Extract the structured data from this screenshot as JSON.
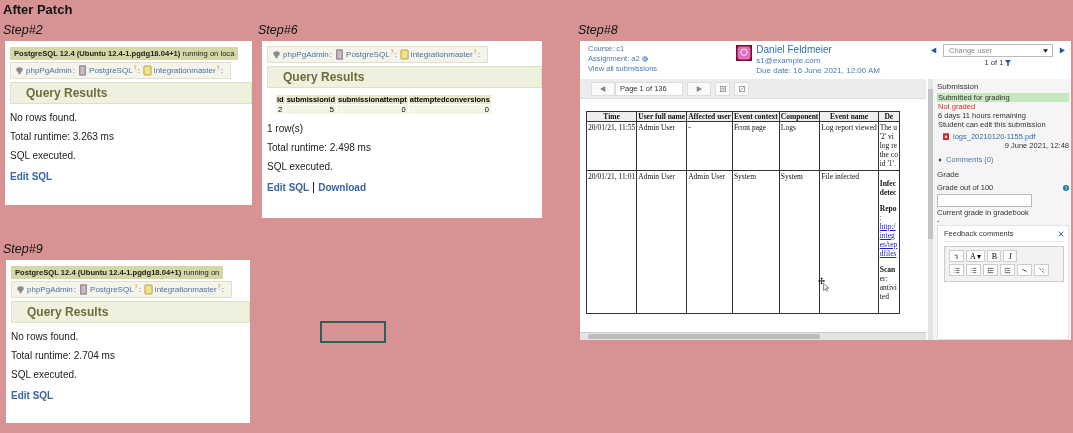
{
  "heading": "After Patch",
  "pg_panels": [
    {
      "step": "Step#2",
      "server_bar": {
        "bold": "PostgreSQL 12.4 (Ubuntu 12.4-1.pgdg18.04+1)",
        "rest": "running on loca"
      },
      "breadcrumb": [
        {
          "kind": "app",
          "label": "phpPgAdmin",
          "sep": ":"
        },
        {
          "kind": "server",
          "label": "PostgreSQL",
          "sep": ":"
        },
        {
          "kind": "database",
          "label": "integrationmaster",
          "sep": ":"
        }
      ],
      "title": "Query Results",
      "lines": [
        "No rows found.",
        "Total runtime: 3.263 ms",
        "SQL executed."
      ],
      "links": [
        "Edit SQL"
      ]
    },
    {
      "step": "Step#6",
      "breadcrumb": [
        {
          "kind": "app",
          "label": "phpPgAdmin",
          "sep": ":"
        },
        {
          "kind": "server",
          "label": "PostgreSQL",
          "sep": ":"
        },
        {
          "kind": "database",
          "label": "integrationmaster",
          "sep": ":"
        }
      ],
      "title": "Query Results",
      "table": {
        "columns": [
          "id",
          "submissionid",
          "submissionattempt",
          "attemptedconversions"
        ],
        "rows": [
          [
            "2",
            "5",
            "0",
            "0"
          ]
        ]
      },
      "lines": [
        "1 row(s)",
        "Total runtime: 2.498 ms",
        "SQL executed."
      ],
      "links": [
        "Edit SQL",
        "Download"
      ]
    },
    {
      "step": "Step#9",
      "server_bar": {
        "bold": "PostgreSQL 12.4 (Ubuntu 12.4-1.pgdg18.04+1)",
        "rest": "running on"
      },
      "breadcrumb": [
        {
          "kind": "app",
          "label": "phpPgAdmin",
          "sep": ":"
        },
        {
          "kind": "server",
          "label": "PostgreSQL",
          "sep": ":"
        },
        {
          "kind": "database",
          "label": "integrationmaster",
          "sep": ":"
        }
      ],
      "title": "Query Results",
      "lines": [
        "No rows found.",
        "Total runtime: 2.704 ms",
        "SQL executed."
      ],
      "links": [
        "Edit SQL"
      ]
    }
  ],
  "grading": {
    "step": "Step#8",
    "course": "Course: c1",
    "assignment": "Assignment: a2",
    "view_all": "View all submissions",
    "user_name": "Daniel Feldmeier",
    "user_email": "s1@example.com",
    "due_date": "Due date: 16 June 2021, 12:00 AM",
    "change_user": {
      "placeholder": "Change user"
    },
    "user_count": "1 of 1",
    "page_field": "Page 1 of 136",
    "log_table": {
      "columns": [
        "Time",
        "User full name",
        "Affected user",
        "Event context",
        "Component",
        "Event name",
        "De"
      ],
      "rows": [
        {
          "cells": [
            "20/01/21, 11:55",
            "Admin User",
            "-",
            "Front page",
            "Logs",
            "Log report viewed"
          ],
          "description": [
            {
              "kind": "text",
              "text": "The u"
            },
            {
              "kind": "text",
              "text": "'2' vi"
            },
            {
              "kind": "text",
              "text": "log re"
            },
            {
              "kind": "text",
              "text": "the co"
            },
            {
              "kind": "text",
              "text": "id '1'."
            }
          ]
        },
        {
          "cells": [
            "20/01/21, 11:01",
            "Admin User",
            "Admin User",
            "System",
            "System",
            "File infected"
          ],
          "description": [
            {
              "kind": "gap"
            },
            {
              "kind": "bold",
              "text": "Infec"
            },
            {
              "kind": "bold",
              "text": "detec"
            },
            {
              "kind": "gap"
            },
            {
              "kind": "bold",
              "text": "Repo"
            },
            {
              "kind": "text",
              "text": ":"
            },
            {
              "kind": "link",
              "text": "http:/"
            },
            {
              "kind": "link",
              "text": "integ"
            },
            {
              "kind": "link",
              "text": "es/tep"
            },
            {
              "kind": "link",
              "text": "dfiles"
            },
            {
              "kind": "gap"
            },
            {
              "kind": "bold",
              "text": "Scan"
            },
            {
              "kind": "text",
              "text": "er:"
            },
            {
              "kind": "text",
              "text": "antivi"
            },
            {
              "kind": "text",
              "text": "ted"
            }
          ]
        }
      ]
    },
    "submission": {
      "title": "Submission",
      "statuses": [
        {
          "kind": "submitted",
          "text": "Submitted for grading"
        },
        {
          "kind": "not-graded",
          "text": "Not graded"
        },
        {
          "kind": "plain",
          "text": "6 days 11 hours remaining"
        },
        {
          "kind": "plain",
          "text": "Student can edit this submission"
        }
      ],
      "file": "logs_20210120-1155.pdf",
      "file_date": "9 June 2021, 12:48",
      "comments": "Comments (0)"
    },
    "grade": {
      "title": "Grade",
      "label": "Grade out of 100",
      "current": "Current grade in gradebook",
      "current_value": "-"
    },
    "feedback": {
      "title": "Feedback comments",
      "toolbar": [
        [
          {
            "kind": "undo"
          },
          {
            "kind": "text",
            "label": "A ▾"
          },
          {
            "kind": "text",
            "label": "B"
          },
          {
            "kind": "text",
            "label": "I",
            "italic": true
          }
        ],
        [
          {
            "kind": "bullets"
          },
          {
            "kind": "numbers"
          },
          {
            "kind": "outdent"
          },
          {
            "kind": "indent"
          },
          {
            "kind": "link"
          },
          {
            "kind": "unlink"
          }
        ]
      ]
    }
  }
}
